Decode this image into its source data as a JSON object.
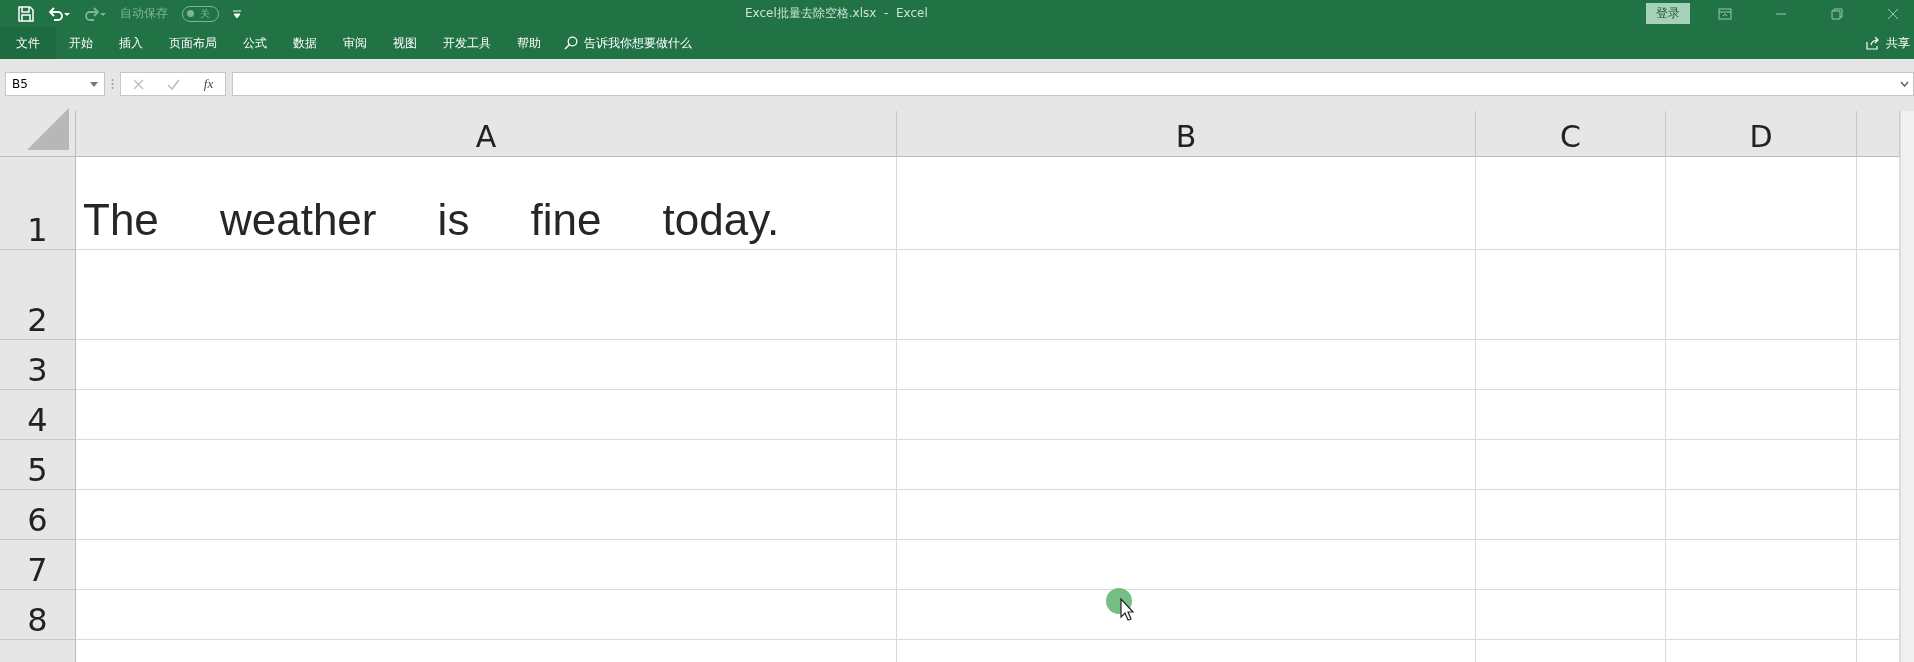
{
  "quick_access": {
    "autosave_label": "自动保存",
    "autosave_toggle": "关",
    "autosave_on": false
  },
  "window": {
    "title": "Excel批量去除空格.xlsx  -  Excel",
    "login": "登录"
  },
  "ribbon_tabs": [
    {
      "label": "文件",
      "selected": false
    },
    {
      "label": "开始",
      "selected": false
    },
    {
      "label": "插入",
      "selected": false
    },
    {
      "label": "页面布局",
      "selected": false
    },
    {
      "label": "公式",
      "selected": false
    },
    {
      "label": "数据",
      "selected": false
    },
    {
      "label": "审阅",
      "selected": false
    },
    {
      "label": "视图",
      "selected": false
    },
    {
      "label": "开发工具",
      "selected": false
    },
    {
      "label": "帮助",
      "selected": false
    }
  ],
  "tell_me": {
    "placeholder": "告诉我你想要做什么"
  },
  "share": "共享",
  "formula_bar": {
    "name_box": "B5",
    "fx": "fx"
  },
  "columns": [
    "A",
    "B",
    "C",
    "D"
  ],
  "rows": [
    {
      "label": "1",
      "cells": [
        "The     weather     is     fine     today.",
        "",
        "",
        ""
      ]
    },
    {
      "label": "2",
      "cells": [
        "",
        "",
        "",
        ""
      ]
    },
    {
      "label": "3",
      "cells": [
        "",
        "",
        "",
        ""
      ]
    },
    {
      "label": "4",
      "cells": [
        "",
        "",
        "",
        ""
      ]
    },
    {
      "label": "5",
      "cells": [
        "",
        "",
        "",
        ""
      ]
    },
    {
      "label": "6",
      "cells": [
        "",
        "",
        "",
        ""
      ]
    },
    {
      "label": "7",
      "cells": [
        "",
        "",
        "",
        ""
      ]
    },
    {
      "label": "8",
      "cells": [
        "",
        "",
        "",
        ""
      ]
    }
  ]
}
